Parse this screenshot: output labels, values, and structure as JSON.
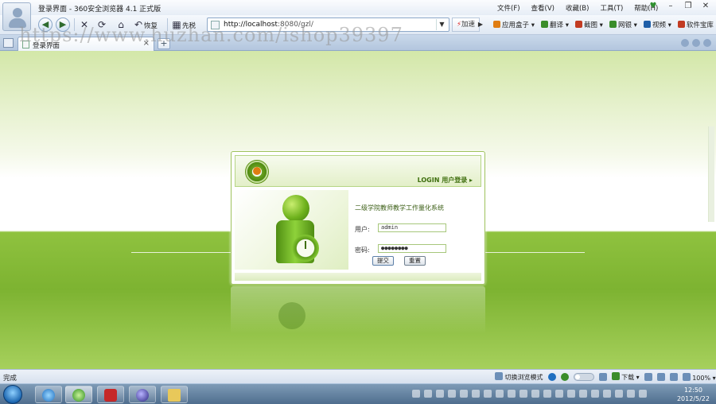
{
  "window": {
    "title": "登录界面 - 360安全浏览器 4.1 正式版",
    "menu": [
      "文件(F)",
      "查看(V)",
      "收藏(B)",
      "工具(T)",
      "帮助(H)"
    ],
    "controls": {
      "minimize": "–",
      "restore": "❐",
      "close": "✕"
    }
  },
  "toolbar": {
    "back_icon": "back-arrow-icon",
    "forward_icon": "forward-arrow-icon",
    "stop": "✕",
    "refresh": "⟳",
    "home": "⌂",
    "undo_label": "恢复",
    "favorites_label": "先税",
    "address": {
      "url_host": "http://localhost",
      "url_rest": ":8080/gzl/"
    },
    "speedup_label": "加速",
    "go": "▶",
    "right_tools": [
      {
        "label": "应用盒子",
        "color": "#e07d12"
      },
      {
        "label": "翻译",
        "color": "#3a8d2a"
      },
      {
        "label": "截图",
        "color": "#c23b22"
      },
      {
        "label": "网银",
        "color": "#3a8d2a"
      },
      {
        "label": "视频",
        "color": "#1f5fa8"
      },
      {
        "label": "软件宝库",
        "color": "#c23b22"
      }
    ]
  },
  "tabs": [
    {
      "label": "登录界面",
      "close": "×"
    }
  ],
  "new_tab": "+",
  "watermark": "https://www.huzhan.com/ishop39397",
  "login": {
    "header_label": "LOGIN 用户登录 ▸",
    "system_name": "二级学院教师教学工作量化系统",
    "username_label": "用户:",
    "username_value": "admin",
    "password_label": "密码:",
    "password_value": "●●●●●●●●",
    "submit_label": "提交",
    "reset_label": "重置"
  },
  "statusbar": {
    "status": "完成",
    "mode_label": "切换浏览模式",
    "download_label": "下载",
    "zoom": "100%"
  },
  "taskbar": {
    "time": "12:50",
    "date": "2012/5/22"
  }
}
